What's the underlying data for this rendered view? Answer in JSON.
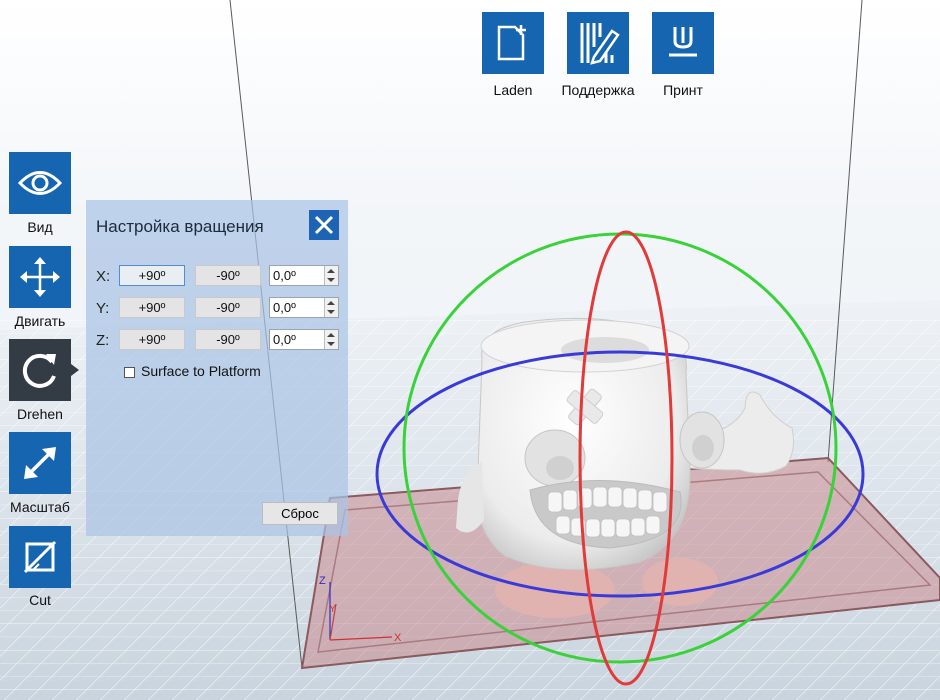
{
  "toolbar": {
    "load_label": "Laden",
    "support_label": "Поддержка",
    "print_label": "Принт"
  },
  "sidebar": {
    "view_label": "Вид",
    "move_label": "Двигать",
    "rotate_label": "Drehen",
    "scale_label": "Масштаб",
    "cut_label": "Cut"
  },
  "rotation_panel": {
    "title": "Настройка вращения",
    "rows": [
      {
        "axis": "X:",
        "plus": "+90º",
        "minus": "-90º",
        "value": "0,0º"
      },
      {
        "axis": "Y:",
        "plus": "+90º",
        "minus": "-90º",
        "value": "0,0º"
      },
      {
        "axis": "Z:",
        "plus": "+90º",
        "minus": "-90º",
        "value": "0,0º"
      }
    ],
    "surface_label": "Surface to Platform",
    "surface_checked": false,
    "reset_label": "Сброс"
  },
  "viewport": {
    "axis_labels": {
      "x": "X",
      "y": "Y",
      "z": "Z"
    },
    "ring_colors": {
      "x": "#e03a3a",
      "y": "#3ad23a",
      "z": "#3a3ad8"
    },
    "accent": "#1565b0"
  }
}
